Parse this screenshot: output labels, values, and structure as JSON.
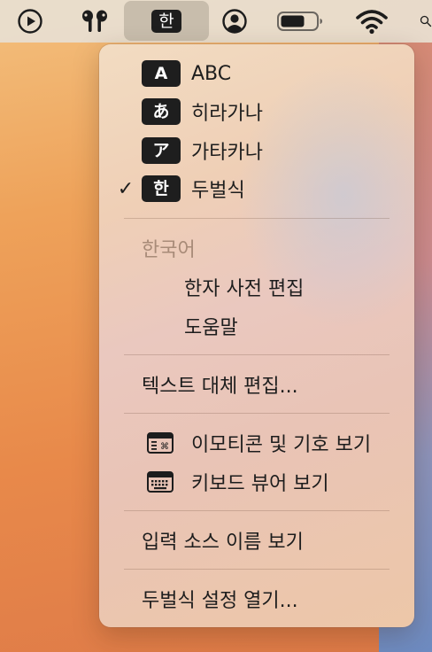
{
  "menubar": {
    "input_indicator": "한",
    "icons": [
      "play-circle-icon",
      "airpods-icon",
      "input-source-icon",
      "user-circle-icon",
      "battery-icon",
      "wifi-icon",
      "search-icon"
    ]
  },
  "menu": {
    "sources": [
      {
        "badge": "A",
        "label": "ABC",
        "checked": false
      },
      {
        "badge": "あ",
        "label": "히라가나",
        "checked": false
      },
      {
        "badge": "ア",
        "label": "가타카나",
        "checked": false
      },
      {
        "badge": "한",
        "label": "두벌식",
        "checked": true
      }
    ],
    "checkmark": "✓",
    "section_header": "한국어",
    "korean_items": [
      "한자 사전 편집",
      "도움말"
    ],
    "text_replacement": "텍스트 대체 편집...",
    "viewer_items": [
      {
        "icon": "emoji-viewer-icon",
        "label": "이모티콘 및 기호 보기"
      },
      {
        "icon": "keyboard-viewer-icon",
        "label": "키보드 뷰어 보기"
      }
    ],
    "show_input_source_name": "입력 소스 이름 보기",
    "open_settings": "두벌식 설정 열기..."
  }
}
